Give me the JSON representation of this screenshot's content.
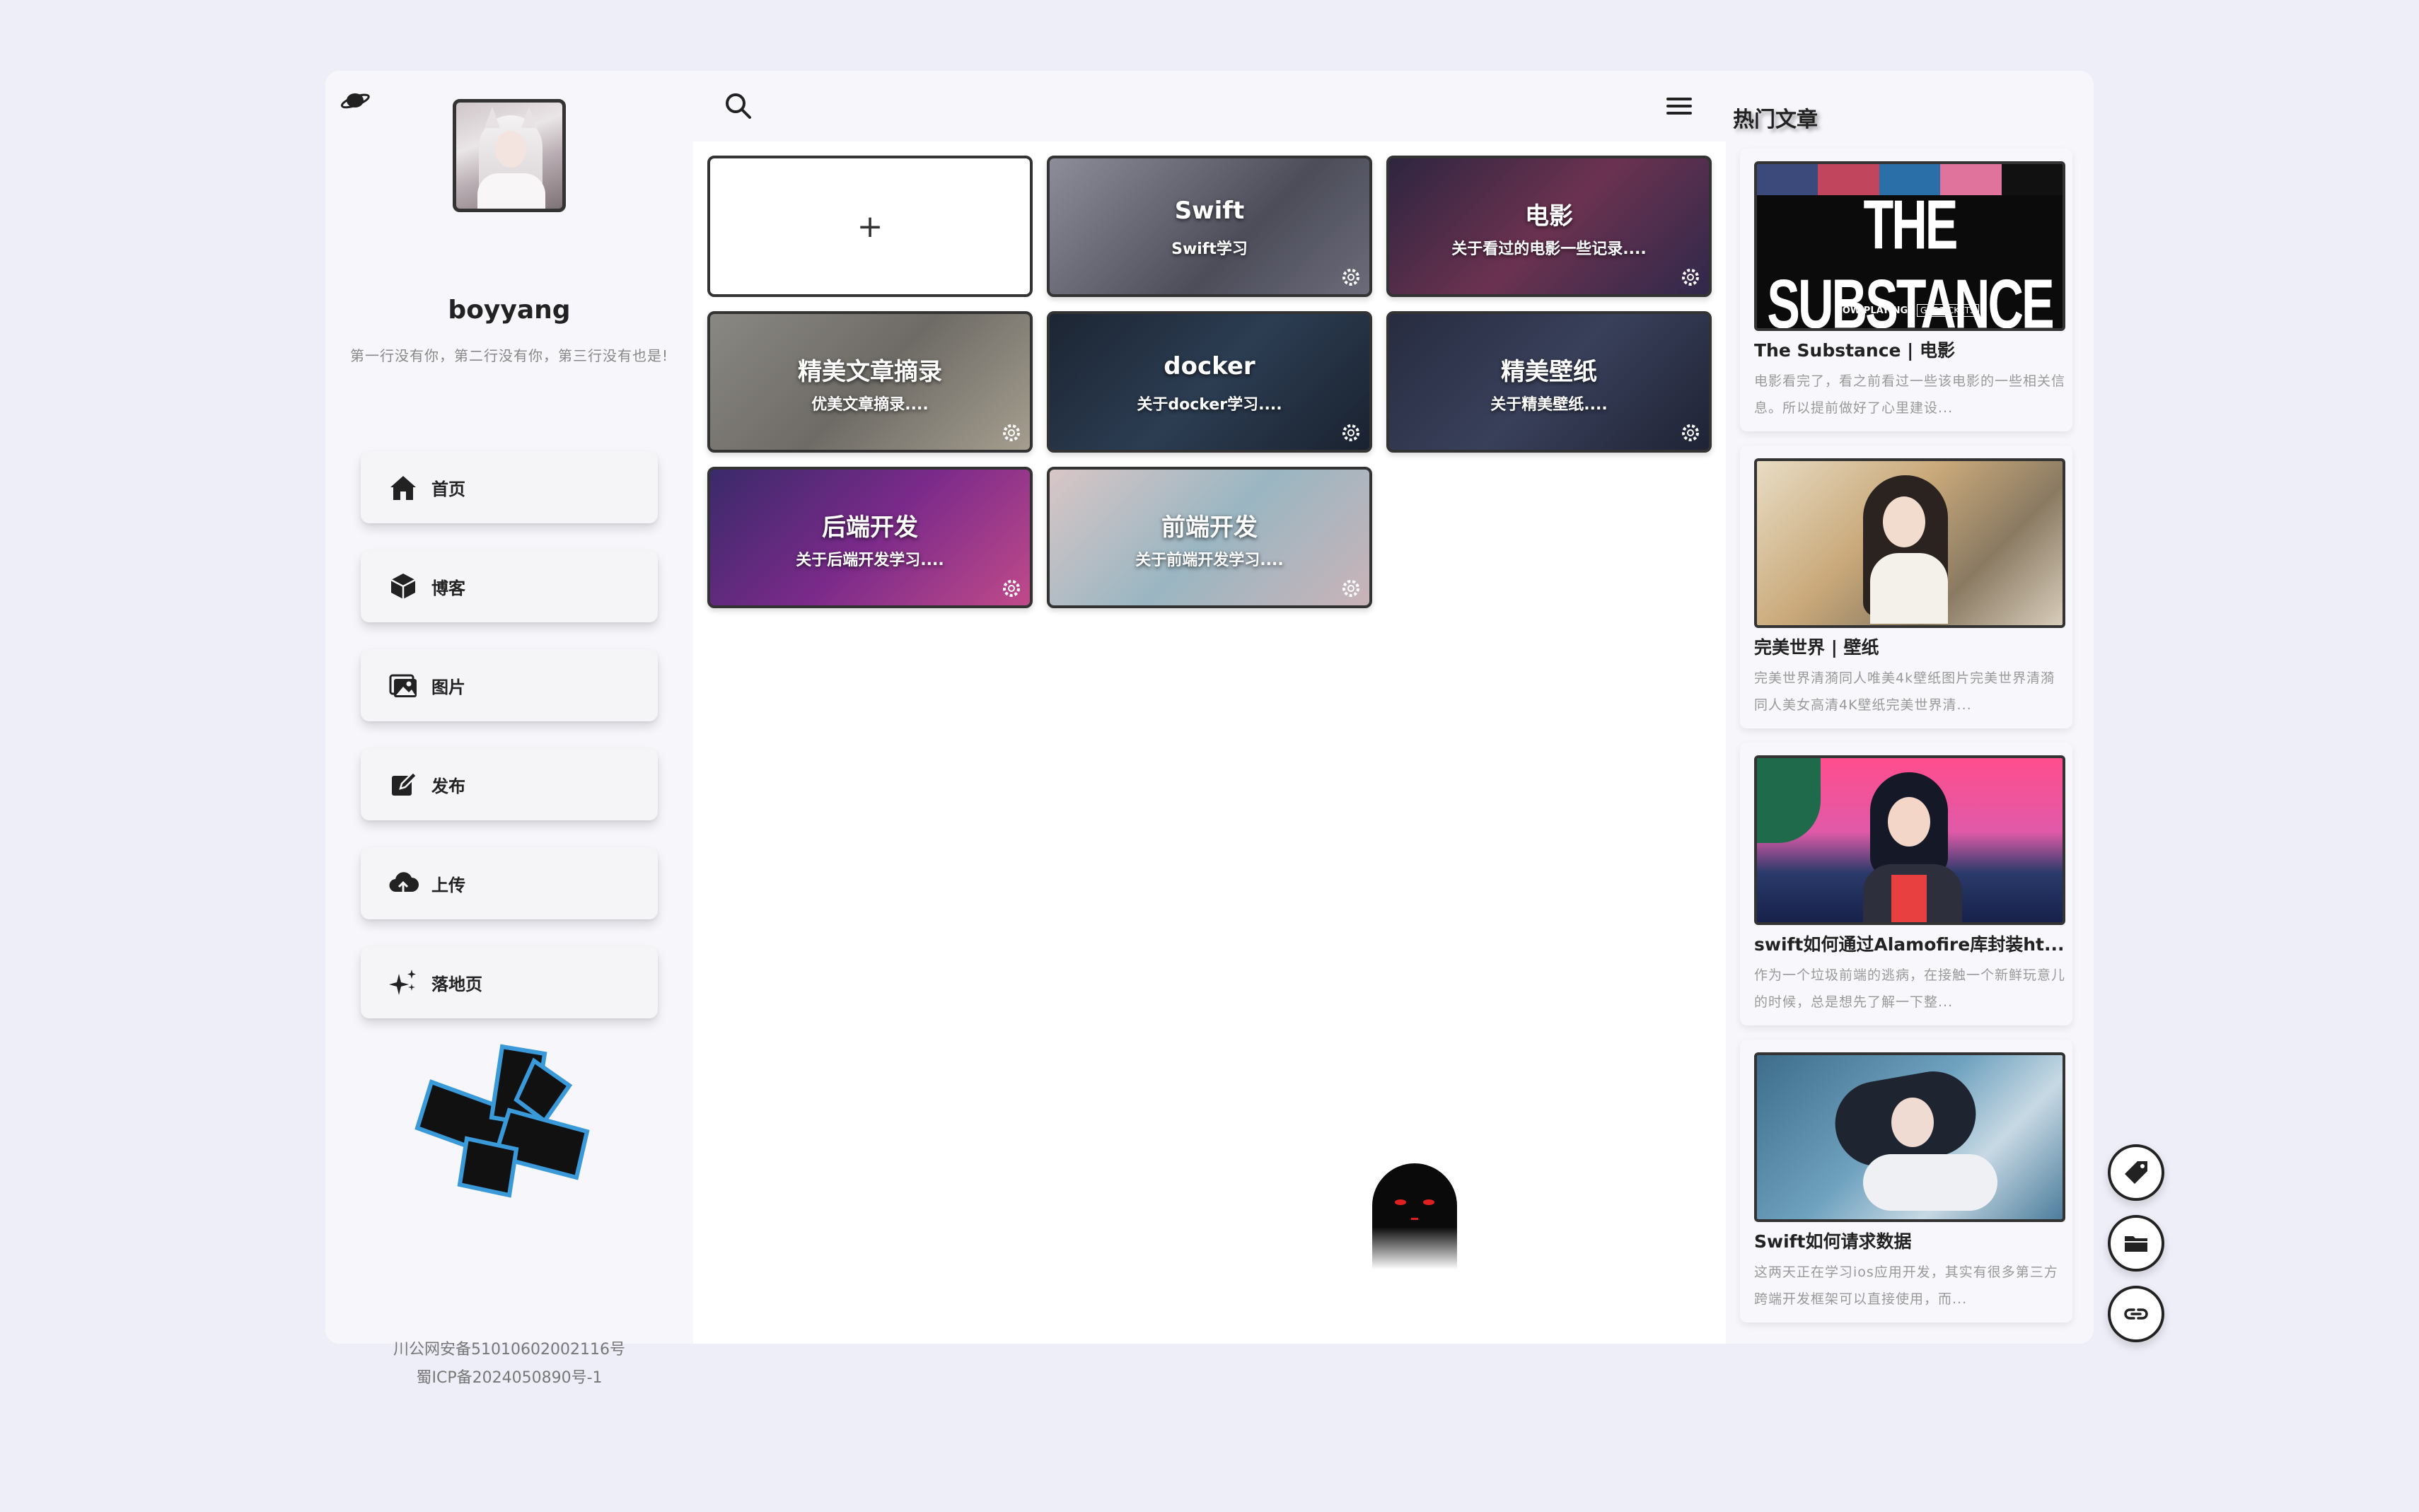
{
  "profile": {
    "username": "boyyang",
    "bio": "第一行没有你，第二行没有你，第三行没有也是!"
  },
  "nav": {
    "items": [
      {
        "label": "首页",
        "icon": "home-icon"
      },
      {
        "label": "博客",
        "icon": "cube-icon"
      },
      {
        "label": "图片",
        "icon": "images-icon"
      },
      {
        "label": "发布",
        "icon": "edit-icon"
      },
      {
        "label": "上传",
        "icon": "cloud-upload-icon"
      },
      {
        "label": "落地页",
        "icon": "sparkles-icon"
      }
    ]
  },
  "footer": {
    "police": "川公网安备51010602002116号",
    "icp": "蜀ICP备2024050890号-1"
  },
  "main": {
    "add_label": "+",
    "cards": [
      {
        "title": "Swift",
        "subtitle": "Swift学习",
        "color": "#6e6f7a"
      },
      {
        "title": "电影",
        "subtitle": "关于看过的电影一些记录....",
        "color": "#4a3150"
      },
      {
        "title": "精美文章摘录",
        "subtitle": "优美文章摘录....",
        "color": "#8a8781"
      },
      {
        "title": "docker",
        "subtitle": "关于docker学习....",
        "color": "#23303f"
      },
      {
        "title": "精美壁纸",
        "subtitle": "关于精美壁纸....",
        "color": "#2d3246"
      },
      {
        "title": "后端开发",
        "subtitle": "关于后端开发学习....",
        "color": "#5b2d7a"
      },
      {
        "title": "前端开发",
        "subtitle": "关于前端开发学习....",
        "color": "#b9a9ad"
      }
    ]
  },
  "hot": {
    "title": "热门文章",
    "posts": [
      {
        "title": "The Substance | 电影",
        "desc": "电影看完了，看之前看过一些该电影的一些相关信息。所以提前做好了心里建设...",
        "thumb_text": "THE SUBSTANCE",
        "thumb_sub": "NOW PLAYING",
        "thumb_btn": "GET TICKETS"
      },
      {
        "title": "完美世界 | 壁纸",
        "desc": "完美世界清漪同人唯美4k壁纸图片完美世界清漪同人美女高清4K壁纸完美世界清..."
      },
      {
        "title": "swift如何通过Alamofire库封装ht...",
        "desc": "作为一个垃圾前端的逃病，在接触一个新鲜玩意儿的时候，总是想先了解一下整..."
      },
      {
        "title": "Swift如何请求数据",
        "desc": "这两天正在学习ios应用开发，其实有很多第三方跨端开发框架可以直接使用，而..."
      }
    ]
  },
  "fabs": [
    {
      "icon": "tag-icon"
    },
    {
      "icon": "folder-icon"
    },
    {
      "icon": "link-icon"
    }
  ]
}
